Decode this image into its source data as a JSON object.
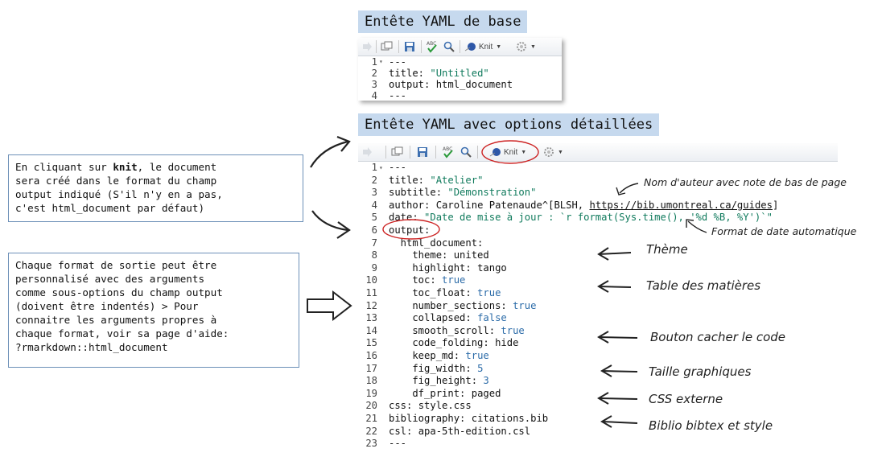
{
  "banner_basic": "Entête YAML de base",
  "banner_detailed": "Entête YAML avec options détaillées",
  "toolbar": {
    "knit_label": "Knit"
  },
  "basic_code": [
    {
      "n": "1",
      "t": "---"
    },
    {
      "n": "2",
      "k": "title:",
      "v": " \"Untitled\"",
      "c": "s"
    },
    {
      "n": "3",
      "k": "output:",
      "v": " html_document",
      "c": "k"
    },
    {
      "n": "4",
      "t": "---"
    }
  ],
  "detailed_code": [
    {
      "n": "1",
      "t": "---"
    },
    {
      "n": "2",
      "k": "title:",
      "v": " \"Atelier\"",
      "c": "s"
    },
    {
      "n": "3",
      "k": "subtitle:",
      "v": " \"Démonstration\"",
      "c": "s"
    },
    {
      "n": "4",
      "k": "author:",
      "v": " Caroline Patenaude^[BLSH, ",
      "c": "k",
      "u": "https://bib.umontreal.ca/guides",
      "after": "]"
    },
    {
      "n": "5",
      "k": "date:",
      "v": " \"Date de mise à jour : `r format(Sys.time(), '%d %B, %Y')`\"",
      "c": "s"
    },
    {
      "n": "6",
      "k": "output:",
      "v": "",
      "c": "k"
    },
    {
      "n": "7",
      "k": "  html_document:",
      "v": "",
      "c": "k"
    },
    {
      "n": "8",
      "k": "    theme:",
      "v": " united",
      "c": "k"
    },
    {
      "n": "9",
      "k": "    highlight:",
      "v": " tango",
      "c": "k"
    },
    {
      "n": "10",
      "k": "    toc:",
      "v": " true",
      "c": "bl"
    },
    {
      "n": "11",
      "k": "    toc_float:",
      "v": " true",
      "c": "bl"
    },
    {
      "n": "12",
      "k": "    number_sections:",
      "v": " true",
      "c": "bl"
    },
    {
      "n": "13",
      "k": "    collapsed:",
      "v": " false",
      "c": "bl"
    },
    {
      "n": "14",
      "k": "    smooth_scroll:",
      "v": " true",
      "c": "bl"
    },
    {
      "n": "15",
      "k": "    code_folding:",
      "v": " hide",
      "c": "k"
    },
    {
      "n": "16",
      "k": "    keep_md:",
      "v": " true",
      "c": "bl"
    },
    {
      "n": "17",
      "k": "    fig_width:",
      "v": " 5",
      "c": "bl"
    },
    {
      "n": "18",
      "k": "    fig_height:",
      "v": " 3",
      "c": "bl"
    },
    {
      "n": "19",
      "k": "    df_print:",
      "v": " paged",
      "c": "k"
    },
    {
      "n": "20",
      "k": "css:",
      "v": " style.css",
      "c": "k"
    },
    {
      "n": "21",
      "k": "bibliography:",
      "v": " citations.bib",
      "c": "k"
    },
    {
      "n": "22",
      "k": "csl:",
      "v": " apa-5th-edition.csl",
      "c": "k"
    },
    {
      "n": "23",
      "t": "---"
    }
  ],
  "note_knit": "En cliquant sur knit, le document\nsera créé dans le format du champ\noutput indiqué (S'il n'y en a pas,\nc'est html_document par défaut)",
  "note_knit_bold": "knit",
  "note_formats": "Chaque format de sortie peut être\npersonnalisé avec des arguments\ncomme sous-options du champ output\n(doivent être indentés) > Pour\nconnaitre les arguments propres à\nchaque format, voir sa page d'aide:\n?rmarkdown::html_document",
  "annotations": {
    "author_note": "Nom d'auteur avec note de bas de page",
    "date_format": "Format de date automatique",
    "theme": "Thème",
    "toc": "Table des matières",
    "code_button": "Bouton cacher le code",
    "fig_size": "Taille graphiques",
    "css": "CSS externe",
    "biblio": "Biblio bibtex et style"
  }
}
